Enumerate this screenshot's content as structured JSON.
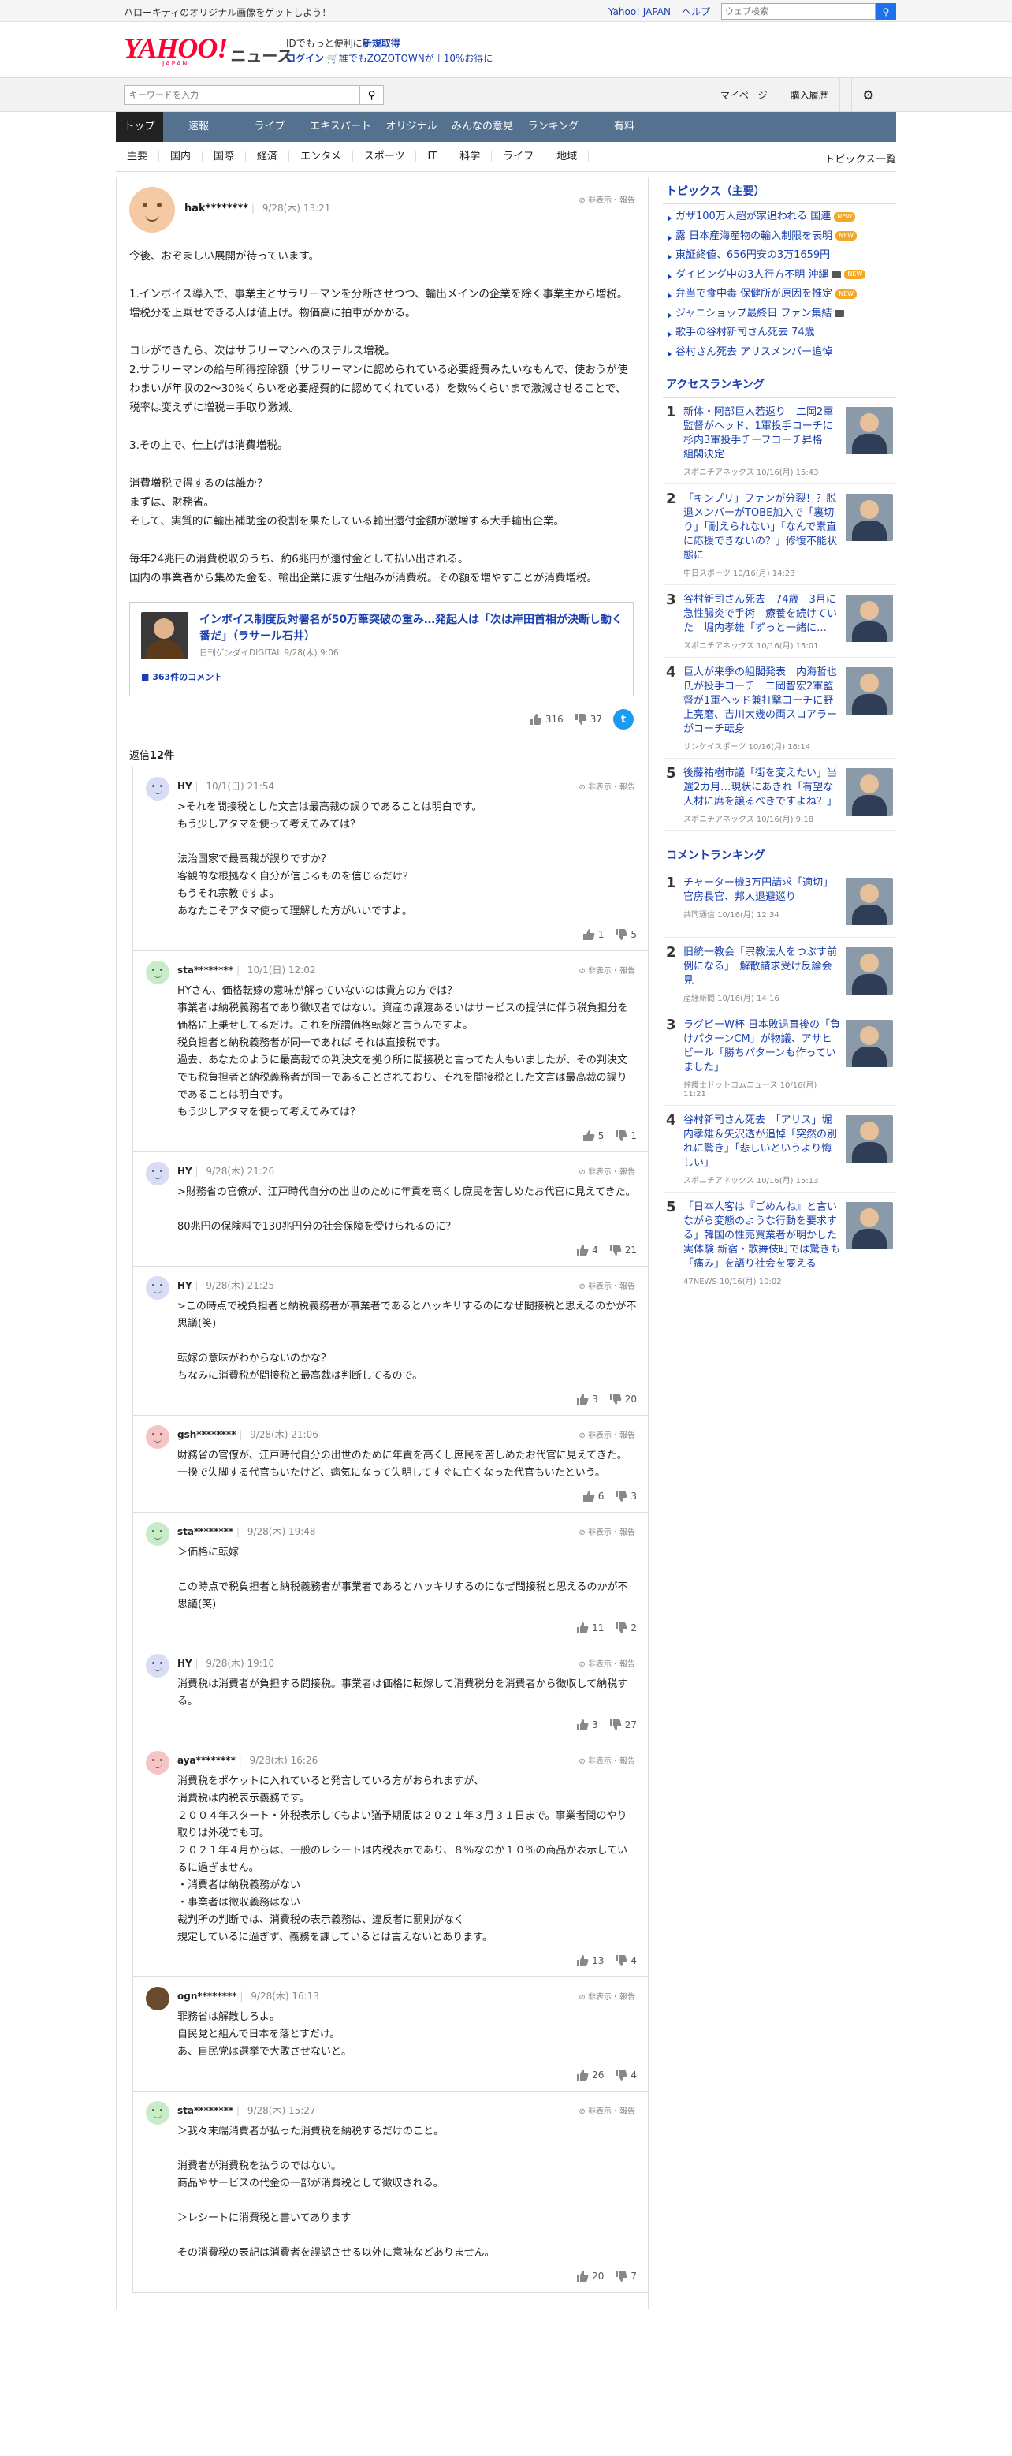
{
  "topbar": {
    "promo": "ハローキティのオリジナル画像をゲットしよう！",
    "yahoo_japan": "Yahoo! JAPAN",
    "help": "ヘルプ",
    "web_search_placeholder": "ウェブ検索"
  },
  "header": {
    "logo_yahoo": "YAHOO!",
    "logo_japan": "JAPAN",
    "logo_news": "ニュース",
    "msg_line1_prefix": "IDでもっと便利に",
    "msg_line1_link": "新規取得",
    "msg_line2_login": "ログイン",
    "msg_line2_rest": "誰でもZOZOTOWNが＋10%お得に"
  },
  "subsearch": {
    "keyword_placeholder": "キーワードを入力",
    "mypage": "マイページ",
    "history": "購入履歴"
  },
  "mainnav": [
    "トップ",
    "速報",
    "ライブ",
    "エキスパート",
    "オリジナル",
    "みんなの意見",
    "ランキング",
    "有料"
  ],
  "catnav": [
    "主要",
    "国内",
    "国際",
    "経済",
    "エンタメ",
    "スポーツ",
    "IT",
    "科学",
    "ライフ",
    "地域"
  ],
  "catnav_all": "トピックス一覧",
  "comment": {
    "user": "hak********",
    "time": "9/28(木) 13:21",
    "report": "非表示・報告",
    "text": "今後、おぞましい展開が待っています。\n\n1.インボイス導入で、事業主とサラリーマンを分断させつつ、輸出メインの企業を除く事業主から増税。増税分を上乗せできる人は値上げ。物価高に拍車がかかる。\n\nコレができたら、次はサラリーマンへのステルス増税。\n2.サラリーマンの給与所得控除額（サラリーマンに認められている必要経費みたいなもんで、使おうが使わまいが年収の2〜30%くらいを必要経費的に認めてくれている）を数%くらいまで激減させることで、税率は変えずに増税＝手取り激減。\n\n3.その上で、仕上げは消費増税。\n\n消費増税で得するのは誰か？\nまずは、財務省。\nそして、実質的に輸出補助金の役割を果たしている輸出還付金額が激増する大手輸出企業。\n\n毎年24兆円の消費税収のうち、約6兆円が還付金として払い出される。\n国内の事業者から集めた金を、輸出企業に渡す仕組みが消費税。その額を増やすことが消費増税。",
    "article": {
      "title": "インボイス制度反対署名が50万筆突破の重み…発起人は「次は岸田首相が決断し動く番だ」（ラサール石井）",
      "source": "日刊ゲンダイDIGITAL 9/28(木) 9:06",
      "comment_count": "363件のコメント"
    },
    "likes": "316",
    "dislikes": "37",
    "twitter_icon": "t"
  },
  "reply_label": "返信",
  "reply_count": "12件",
  "replies": [
    {
      "user": "HY",
      "time": "10/1(日) 21:54",
      "color": "#d8dcf5",
      "text": ">それを間接税とした文言は最高裁の誤りであることは明白です。\nもう少しアタマを使って考えてみては？\n\n法治国家で最高裁が誤りですか？\n客観的な根拠なく自分が信じるものを信じるだけ？\nもうそれ宗教ですよ。\nあなたこそアタマ使って理解した方がいいですよ。",
      "likes": "1",
      "dislikes": "5"
    },
    {
      "user": "sta********",
      "time": "10/1(日) 12:02",
      "color": "#c8ecc8",
      "text": "HYさん、価格転嫁の意味が解っていないのは貴方の方では？\n事業者は納税義務者であり徴収者ではない。資産の譲渡あるいはサービスの提供に伴う税負担分を価格に上乗せしてるだけ。これを所謂価格転嫁と言うんですよ。\n税負担者と納税義務者が同一であれば それは直接税です。\n過去、あなたのように最高裁での判決文を拠り所に間接税と言ってた人もいましたが、その判決文でも税負担者と納税義務者が同一であることされており、それを間接税とした文言は最高裁の誤りであることは明白です。\nもう少しアタマを使って考えてみては？",
      "likes": "5",
      "dislikes": "1"
    },
    {
      "user": "HY",
      "time": "9/28(木) 21:26",
      "color": "#d8dcf5",
      "text": ">財務省の官僚が、江戸時代自分の出世のために年貢を高くし庶民を苦しめたお代官に見えてきた。\n\n80兆円の保険料で130兆円分の社会保障を受けられるのに？",
      "likes": "4",
      "dislikes": "21"
    },
    {
      "user": "HY",
      "time": "9/28(木) 21:25",
      "color": "#d8dcf5",
      "text": ">この時点で税負担者と納税義務者が事業者であるとハッキリするのになぜ間接税と思えるのかが不思議(笑)\n\n転嫁の意味がわからないのかな？\nちなみに消費税が間接税と最高裁は判断してるので。",
      "likes": "3",
      "dislikes": "20"
    },
    {
      "user": "gsh********",
      "time": "9/28(木) 21:06",
      "color": "#f6c4c4",
      "text": "財務省の官僚が、江戸時代自分の出世のために年貢を高くし庶民を苦しめたお代官に見えてきた。一揆で失脚する代官もいたけど、病気になって失明してすぐに亡くなった代官もいたという。",
      "likes": "6",
      "dislikes": "3"
    },
    {
      "user": "sta********",
      "time": "9/28(木) 19:48",
      "color": "#c8ecc8",
      "text": "＞価格に転嫁\n\nこの時点で税負担者と納税義務者が事業者であるとハッキリするのになぜ間接税と思えるのかが不思議(笑)",
      "likes": "11",
      "dislikes": "2"
    },
    {
      "user": "HY",
      "time": "9/28(木) 19:10",
      "color": "#d8dcf5",
      "text": "消費税は消費者が負担する間接税。事業者は価格に転嫁して消費税分を消費者から徴収して納税する。",
      "likes": "3",
      "dislikes": "27"
    },
    {
      "user": "aya********",
      "time": "9/28(木) 16:26",
      "color": "#f6c4c4",
      "text": "消費税をポケットに入れていると発言している方がおられますが、\n消費税は内税表示義務です。\n２００４年スタート・外税表示してもよい猶予期間は２０２１年３月３１日まで。事業者間のやり取りは外税でも可。\n２０２１年４月からは、一般のレシートは内税表示であり、８％なのか１０％の商品か表示しているに過ぎません。\n・消費者は納税義務がない\n・事業者は徴収義務はない\n裁判所の判断では、消費税の表示義務は、違反者に罰則がなく\n規定しているに過ぎず、義務を課しているとは言えないとあります。",
      "likes": "13",
      "dislikes": "4"
    },
    {
      "user": "ogn********",
      "time": "9/28(木) 16:13",
      "color": "#6b4a2b",
      "text": "罪務省は解散しろよ。\n自民党と組んで日本を落とすだけ。\nあ、自民党は選挙で大敗させないと。",
      "likes": "26",
      "dislikes": "4"
    },
    {
      "user": "sta********",
      "time": "9/28(木) 15:27",
      "color": "#c8ecc8",
      "text": "＞我々末端消費者が払った消費税を納税するだけのこと。\n\n消費者が消費税を払うのではない。\n商品やサービスの代金の一部が消費税として徴収される。\n\n＞レシートに消費税と書いてあります\n\nその消費税の表記は消費者を誤認させる以外に意味などありません。",
      "likes": "20",
      "dislikes": "7"
    }
  ],
  "sidebar": {
    "topics_title": "トピックス（主要）",
    "new_label": "NEW",
    "topics": [
      {
        "text": "ガザ100万人超が家追われる 国連",
        "badge": "new"
      },
      {
        "text": "露 日本産海産物の輸入制限を表明",
        "badge": "new"
      },
      {
        "text": "東証終値、656円安の3万1659円",
        "badge": ""
      },
      {
        "text": "ダイビング中の3人行方不明 沖縄",
        "badge": "camnew"
      },
      {
        "text": "弁当で食中毒 保健所が原因を推定",
        "badge": "new"
      },
      {
        "text": "ジャニショップ最終日 ファン集結",
        "badge": "cam"
      },
      {
        "text": "歌手の谷村新司さん死去 74歳",
        "badge": ""
      },
      {
        "text": "谷村さん死去 アリスメンバー追悼",
        "badge": ""
      }
    ],
    "access_title": "アクセスランキング",
    "access": [
      {
        "num": "1",
        "title": "新体・阿部巨人若返り　二岡2軍監督がヘッド、1軍投手コーチに杉内3軍投手チーフコーチ昇格　組閣決定",
        "source": "スポニチアネックス 10/16(月) 15:43"
      },
      {
        "num": "2",
        "title": "「キンプリ」ファンが分裂！？脱退メンバーがTOBE加入で「裏切り」「耐えられない」「なんで素直に応援できないの？」修復不能状態に",
        "source": "中日スポーツ 10/16(月) 14:23"
      },
      {
        "num": "3",
        "title": "谷村新司さん死去　74歳　3月に急性腸炎で手術　療養を続けていた　堀内孝雄「ずっと一緒に…",
        "source": "スポニチアネックス 10/16(月) 15:01"
      },
      {
        "num": "4",
        "title": "巨人が来季の組閣発表　内海哲也氏が投手コーチ　二岡智宏2軍監督が1軍ヘッド兼打撃コーチに野上亮磨、吉川大幾の両スコアラーがコーチ転身",
        "source": "サンケイスポーツ 10/16(月) 16:14"
      },
      {
        "num": "5",
        "title": "後藤祐樹市議「街を変えたい」当選2カ月…現状にあきれ「有望な人材に席を譲るべきですよね？」",
        "source": "スポニチアネックス 10/16(月) 9:18"
      }
    ],
    "comment_title": "コメントランキング",
    "comments": [
      {
        "num": "1",
        "title": "チャーター機3万円請求「適切」官房長官、邦人退避巡り",
        "source": "共同通信 10/16(月) 12:34"
      },
      {
        "num": "2",
        "title": "旧統一教会「宗教法人をつぶす前例になる」　解散請求受け反論会見",
        "source": "産経新聞 10/16(月) 14:16"
      },
      {
        "num": "3",
        "title": "ラグビーW杯 日本敗退直後の「負けパターンCM」が物議、アサヒビール「勝ちパターンも作っていました」",
        "source": "弁護士ドットコムニュース 10/16(月) 11:21"
      },
      {
        "num": "4",
        "title": "谷村新司さん死去　「アリス」堀内孝雄＆矢沢透が追悼「突然の別れに驚き」「悲しいというより悔しい」",
        "source": "スポニチアネックス 10/16(月) 15:13"
      },
      {
        "num": "5",
        "title": "「日本人客は『ごめんね』と言いながら変態のような行動を要求する」韓国の性売買業者が明かした実体験 新宿・歌舞伎町では驚きも　「痛み」を語り社会を変える",
        "source": "47NEWS 10/16(月) 10:02"
      }
    ]
  }
}
